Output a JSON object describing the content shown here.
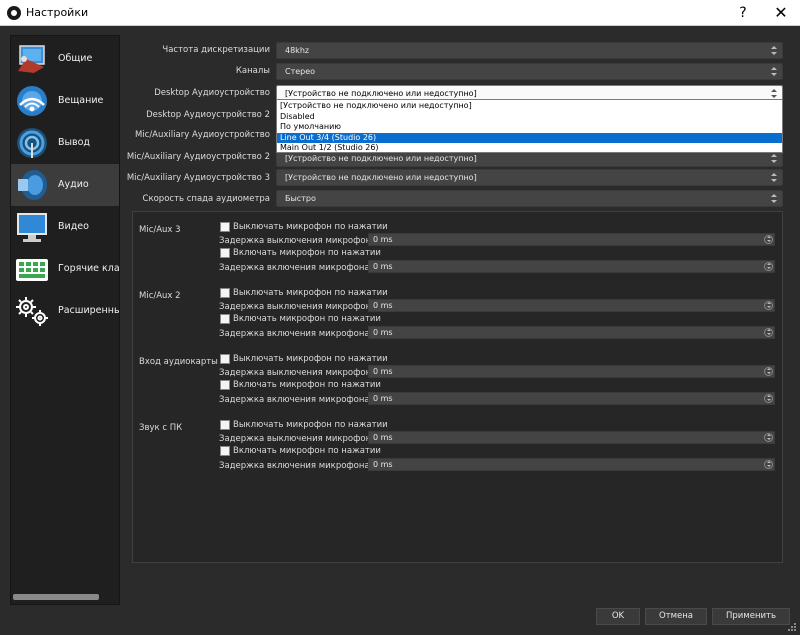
{
  "window": {
    "title": "Настройки",
    "help": "?",
    "close": "✕"
  },
  "sidebar": {
    "items": [
      {
        "label": "Общие",
        "icon": "general-icon"
      },
      {
        "label": "Вещание",
        "icon": "broadcast-icon"
      },
      {
        "label": "Вывод",
        "icon": "output-icon"
      },
      {
        "label": "Аудио",
        "icon": "audio-icon",
        "active": true
      },
      {
        "label": "Видео",
        "icon": "video-icon"
      },
      {
        "label": "Горячие клав",
        "icon": "hotkeys-icon"
      },
      {
        "label": "Расширенные",
        "icon": "advanced-icon"
      }
    ]
  },
  "audio": {
    "sample_rate": {
      "label": "Частота дискретизации",
      "value": "48khz"
    },
    "channels": {
      "label": "Каналы",
      "value": "Стерео"
    },
    "desktop1": {
      "label": "Desktop Аудиоустройство",
      "value": "[Устройство не подключено или недоступно]"
    },
    "desktop2": {
      "label": "Desktop Аудиоустройство 2"
    },
    "mic1": {
      "label": "Mic/Auxiliary Аудиоустройство"
    },
    "mic2": {
      "label": "Mic/Auxiliary Аудиоустройство 2",
      "value": "[Устройство не подключено или недоступно]"
    },
    "mic3": {
      "label": "Mic/Auxiliary Аудиоустройство 3",
      "value": "[Устройство не подключено или недоступно]"
    },
    "meter_decay": {
      "label": "Скорость спада аудиометра",
      "value": "Быстро"
    }
  },
  "dropdown": {
    "options": [
      "[Устройство не подключено или недоступно]",
      "Disabled",
      "По умолчанию",
      "Line Out 3/4 (Studio 26)",
      "Main Out 1/2 (Studio 26)"
    ],
    "selected_index": 3
  },
  "groups": [
    {
      "name": "Mic/Aux 3",
      "ptm": "Выключать микрофон по нажатии",
      "ptm_delay": "Задержка выключения микрофона",
      "ptm_value": "0 ms",
      "ptt": "Включать микрофон по нажатии",
      "ptt_delay": "Задержка включения микрофона",
      "ptt_value": "0 ms"
    },
    {
      "name": "Mic/Aux 2",
      "ptm": "Выключать микрофон по нажатии",
      "ptm_delay": "Задержка выключения микрофона",
      "ptm_value": "0 ms",
      "ptt": "Включать микрофон по нажатии",
      "ptt_delay": "Задержка включения микрофона",
      "ptt_value": "0 ms"
    },
    {
      "name": "Вход аудиокарты",
      "ptm": "Выключать микрофон по нажатии",
      "ptm_delay": "Задержка выключения микрофона",
      "ptm_value": "0 ms",
      "ptt": "Включать микрофон по нажатии",
      "ptt_delay": "Задержка включения микрофона",
      "ptt_value": "0 ms"
    },
    {
      "name": "Звук с ПК",
      "ptm": "Выключать микрофон по нажатии",
      "ptm_delay": "Задержка выключения микрофона",
      "ptm_value": "0 ms",
      "ptt": "Включать микрофон по нажатии",
      "ptt_delay": "Задержка включения микрофона",
      "ptt_value": "0 ms"
    }
  ],
  "buttons": {
    "ok": "OK",
    "cancel": "Отмена",
    "apply": "Применить"
  },
  "colors": {
    "background": "#2b2b2b",
    "selection": "#0a6ed1",
    "active_nav": "#3c3c3c"
  }
}
